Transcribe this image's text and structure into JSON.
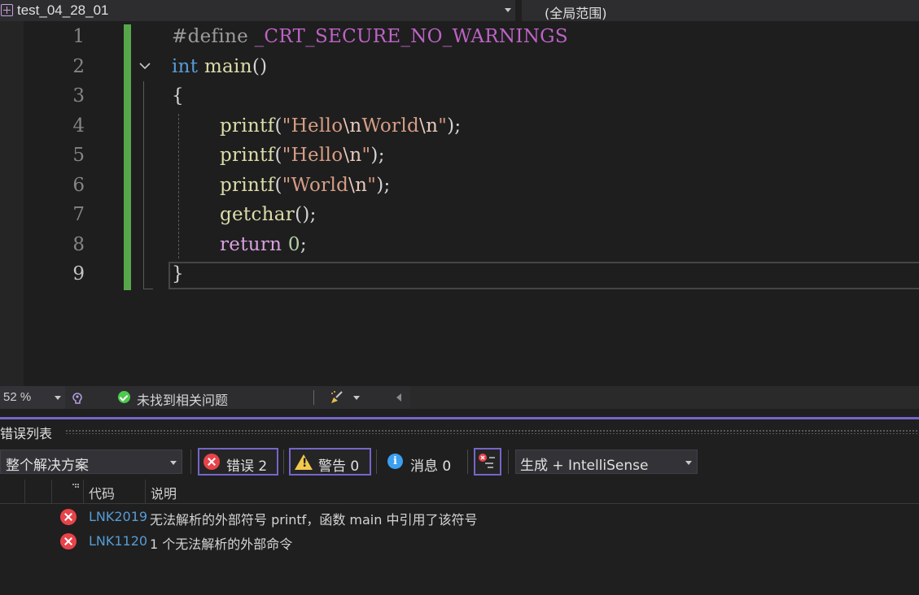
{
  "navbar": {
    "project": "test_04_28_01",
    "scope": "(全局范围)"
  },
  "editor": {
    "line_numbers": [
      "1",
      "2",
      "3",
      "4",
      "5",
      "6",
      "7",
      "8",
      "9"
    ],
    "current_line": "9",
    "lines": {
      "l1": {
        "pre": "#define ",
        "macro": "_CRT_SECURE_NO_WARNINGS"
      },
      "l2": {
        "kw": "int",
        "fn": "main",
        "punc": "()"
      },
      "l3": {
        "punc": "{"
      },
      "l4": {
        "fn": "printf",
        "open": "(",
        "q1": "\"",
        "s1": "Hello",
        "e1": "\\n",
        "s2": "World",
        "e2": "\\n",
        "q2": "\"",
        "close": ");"
      },
      "l5": {
        "fn": "printf",
        "open": "(",
        "q1": "\"",
        "s1": "Hello",
        "e1": "\\n",
        "q2": "\"",
        "close": ");"
      },
      "l6": {
        "fn": "printf",
        "open": "(",
        "q1": "\"",
        "s1": "World",
        "e1": "\\n",
        "q2": "\"",
        "close": ");"
      },
      "l7": {
        "fn": "getchar",
        "close": "();"
      },
      "l8": {
        "kw": "return",
        "num": "0",
        "close": ";"
      },
      "l9": {
        "punc": "}"
      }
    }
  },
  "status": {
    "zoom": "52 %",
    "issues": "未找到相关问题"
  },
  "error_list": {
    "title": "错误列表",
    "scope_filter": "整个解决方案",
    "errors_label": "错误 2",
    "warnings_label": "警告 0",
    "messages_label": "消息 0",
    "source_filter": "生成 + IntelliSense",
    "columns": {
      "code": "代码",
      "description": "说明"
    },
    "rows": [
      {
        "code": "LNK2019",
        "description": "无法解析的外部符号 printf，函数 main 中引用了该符号"
      },
      {
        "code": "LNK1120",
        "description": "1 个无法解析的外部命令"
      }
    ]
  },
  "colors": {
    "accent": "#7566c8",
    "change_bar": "#57a64a",
    "error": "#e8434a",
    "warning": "#f2c94c",
    "info": "#3c9ff0"
  },
  "icons": [
    "project-icon",
    "chevron-down-icon",
    "fold-icon",
    "intellicode-icon",
    "check-circle-icon",
    "code-cleanup-brush-icon",
    "error-icon",
    "warning-icon",
    "info-icon",
    "filter-icon"
  ]
}
